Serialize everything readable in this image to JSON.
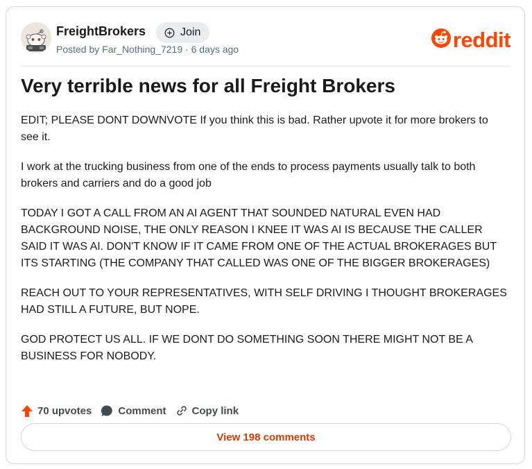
{
  "header": {
    "subreddit": "FreightBrokers",
    "join_label": "Join",
    "posted_by": "Posted by Far_Nothing_7219 · 6 days ago",
    "logo_text": "reddit"
  },
  "post": {
    "title": "Very terrible news for all Freight Brokers",
    "paragraphs": [
      "EDIT; PLEASE DONT DOWNVOTE If you think this is bad. Rather upvote it for more brokers to see it.",
      "I work at the trucking business from one of the ends to process payments usually talk to both brokers and carriers and do a good job",
      "TODAY I GOT A CALL FROM AN AI AGENT THAT SOUNDED NATURAL EVEN HAD BACKGROUND NOISE, THE ONLY REASON I KNEE IT WAS AI IS BECAUSE THE CALLER SAID IT WAS AI. DON'T KNOW IF IT CAME FROM ONE OF THE ACTUAL BROKERAGES BUT ITS STARTING (THE COMPANY THAT CALLED WAS ONE OF THE BIGGER BROKERAGES)",
      "REACH OUT TO YOUR REPRESENTATIVES, WITH SELF DRIVING I THOUGHT BROKERAGES HAD STILL A FUTURE, BUT NOPE.",
      "GOD PROTECT US ALL. IF WE DONT DO SOMETHING SOON THERE MIGHT NOT BE A BUSINESS FOR NOBODY."
    ]
  },
  "actions": {
    "upvotes": "70 upvotes",
    "comment": "Comment",
    "copy_link": "Copy link",
    "view_comments": "View 198 comments"
  },
  "colors": {
    "brand": "#ff4500",
    "upvote": "#ff4500",
    "link_text": "#d93a00"
  },
  "icons": [
    "subreddit-avatar-icon",
    "plus-circle-icon",
    "reddit-snoo-icon",
    "upvote-arrow-icon",
    "comment-bubble-icon",
    "link-chain-icon"
  ]
}
